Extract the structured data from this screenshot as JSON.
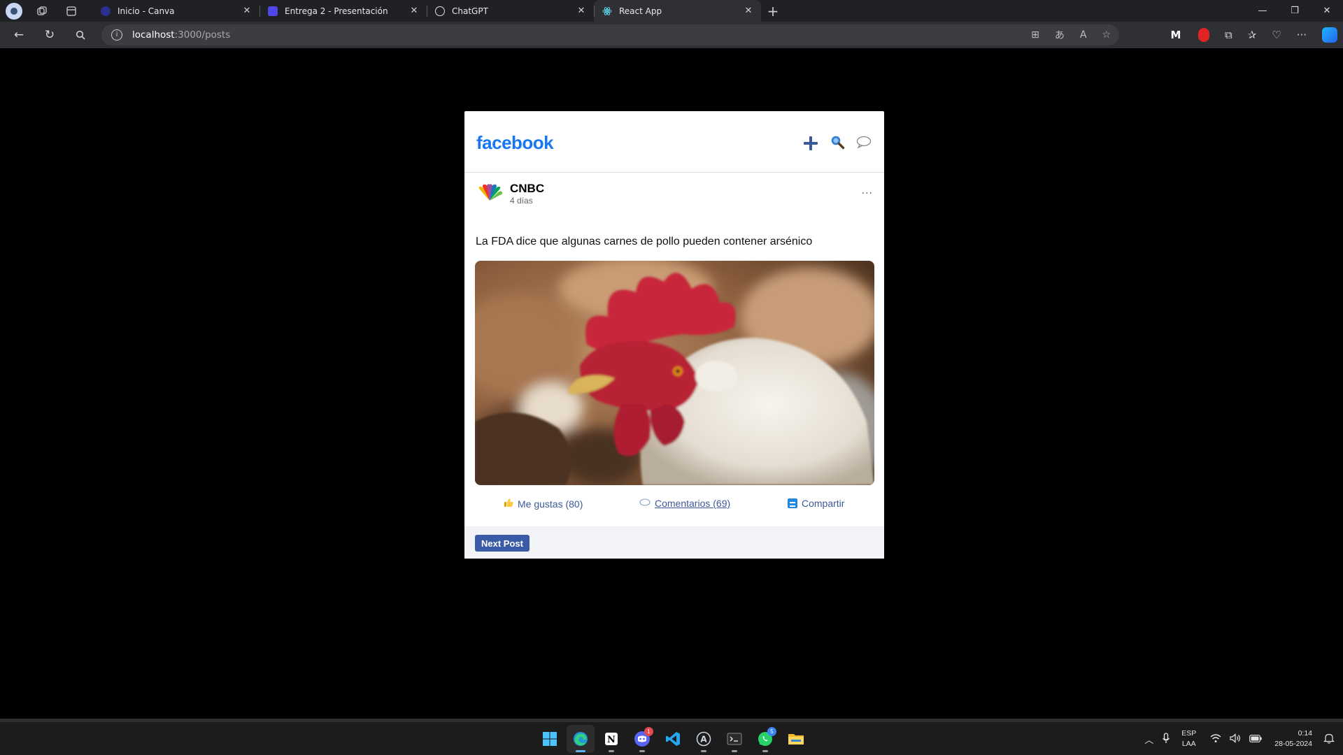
{
  "browser": {
    "tabs": [
      {
        "title": "Inicio - Canva",
        "favicon_color": "#7b2ff7",
        "active": false
      },
      {
        "title": "Entrega 2 - Presentación",
        "favicon_color": "#4f46e5",
        "active": false
      },
      {
        "title": "ChatGPT",
        "favicon_color": "#e5e5e5",
        "active": false
      },
      {
        "title": "React App",
        "favicon_color": "#61dafb",
        "active": true
      }
    ],
    "address": {
      "host": "localhost",
      "path": ":3000/posts"
    }
  },
  "app": {
    "logo": "facebook",
    "post": {
      "author": "CNBC",
      "time": "4 días",
      "more": "···",
      "text": "La FDA dice que algunas carnes de pollo pueden contener arsénico",
      "image_subject": "rooster-photo",
      "actions": {
        "like_label": "Me gustas (80)",
        "comments_label": "Comentarios (69)",
        "share_label": "Compartir"
      }
    },
    "next_button": "Next Post"
  },
  "taskbar": {
    "apps": [
      "windows-start",
      "edge",
      "notion",
      "discord",
      "vscode",
      "app-a",
      "terminal",
      "whatsapp",
      "file-explorer"
    ],
    "discord_badge": "1",
    "whatsapp_badge": "5",
    "language": {
      "line1": "ESP",
      "line2": "LAA"
    },
    "clock": {
      "time": "0:14",
      "date": "28-05-2024"
    }
  },
  "colors": {
    "facebook_blue": "#1877f2",
    "link_blue": "#3b5998",
    "button_blue": "#3b5ba6",
    "browser_chrome": "#2f3033",
    "page_background": "#000000"
  }
}
